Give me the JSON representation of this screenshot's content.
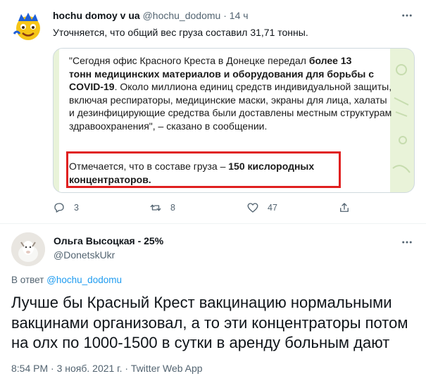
{
  "tweet": {
    "author_name": "hochu domoy v ua",
    "author_handle": "@hochu_dodomu",
    "separator": "·",
    "time": "14 ч",
    "text": "Уточняется, что общий вес груза составил 31,71 тонны.",
    "media": {
      "q_open": "\"Сегодня офис Красного Креста в Донецке передал ",
      "q_bold1": "более 13",
      "q_bold2": "тонн медицинских материалов и оборудования для борьбы с",
      "q_bold3": "COVID-19",
      "q_rest": ". Около миллиона единиц средств индивидуальной защиты, включая респираторы, медицинские маски, экраны для лица, халаты и дезинфицирующие средства были доставлены местным структурам здравоохранения\", – сказано в сообщении.",
      "note_plain": "Отмечается, что в составе груза – ",
      "note_bold1": "150 кислородных",
      "note_bold2": "концентраторов."
    },
    "actions": {
      "reply_count": "3",
      "retweet_count": "8",
      "like_count": "47"
    }
  },
  "reply": {
    "author_name": "Ольга Высоцкая - 25%",
    "author_handle": "@DonetskUkr",
    "reply_prefix": "В ответ",
    "reply_mention": "@hochu_dodomu",
    "text": "Лучше бы Красный Крест вакцинацию нормальными вакцинами организовал, а то эти концентраторы потом на олх по 1000-1500 в сутки в аренду больным дают",
    "meta": "8:54 PM · 3 нояб. 2021 г. · Twitter Web App"
  },
  "icons": {
    "more": "more-icon",
    "reply": "reply-icon",
    "retweet": "retweet-icon",
    "like": "heart-icon",
    "share": "share-icon"
  },
  "colors": {
    "text": "#0f1419",
    "secondary": "#536471",
    "link": "#1d9bf0",
    "highlight_box": "#e02020"
  }
}
